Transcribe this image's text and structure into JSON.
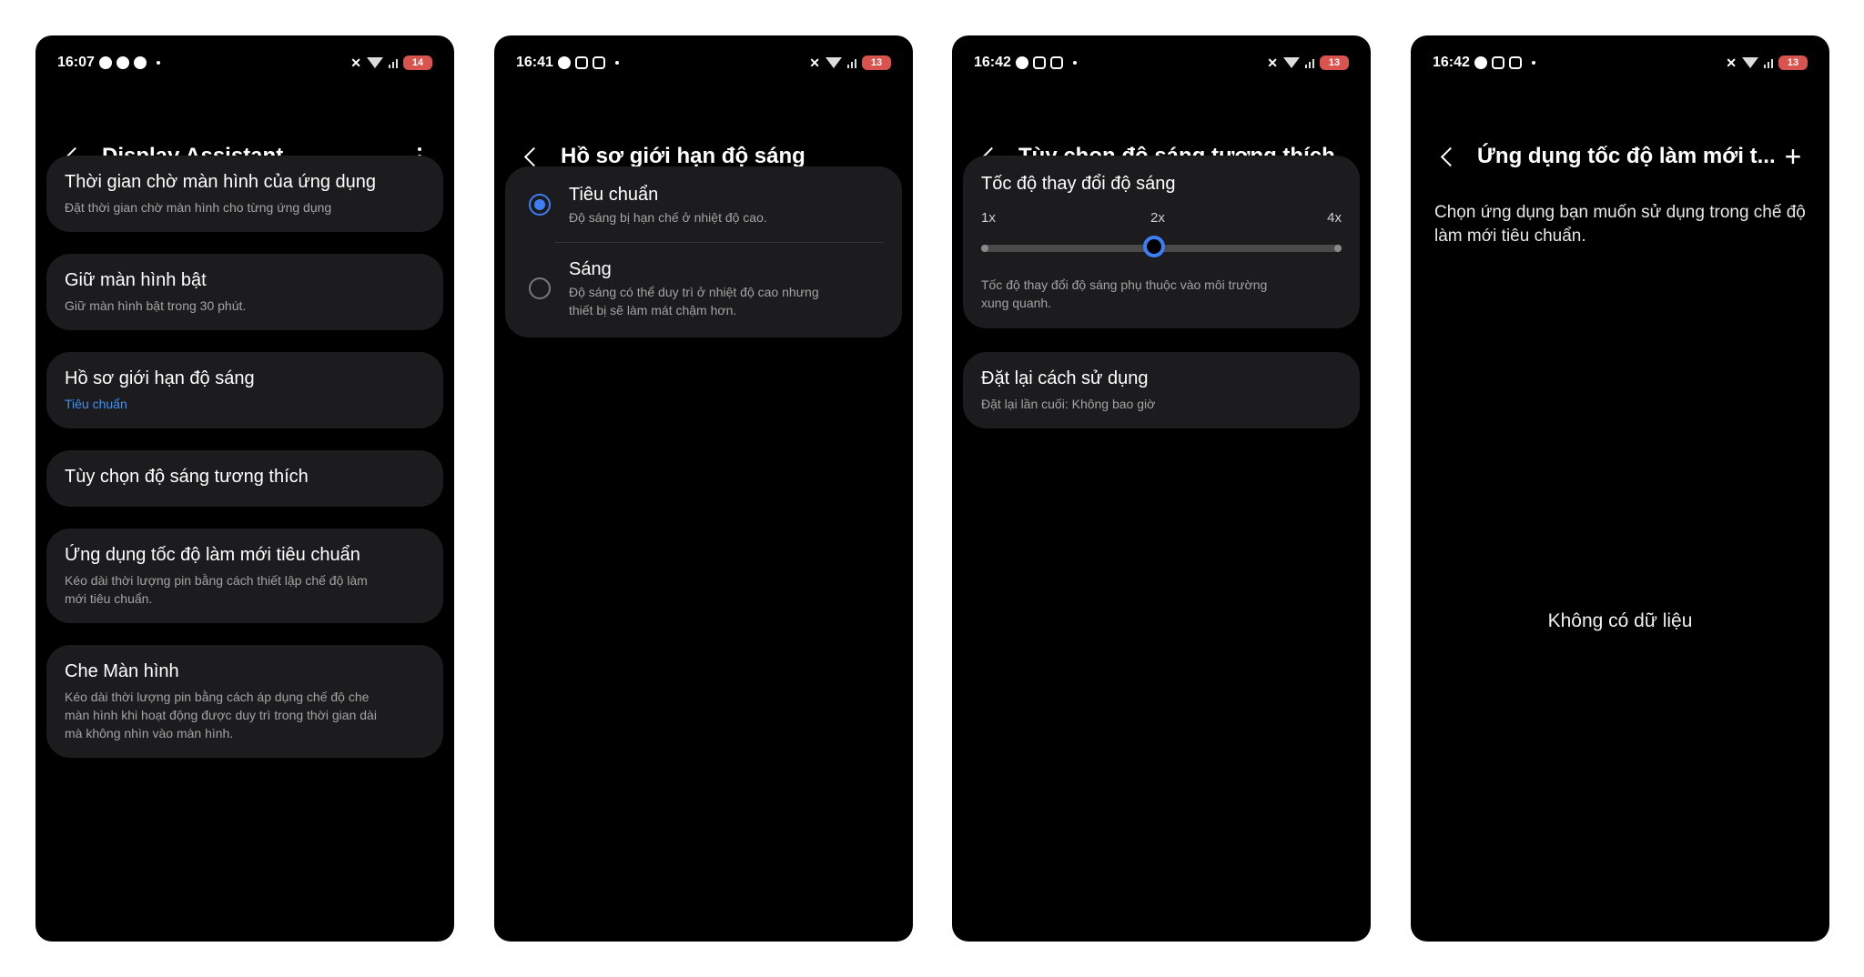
{
  "screens": [
    {
      "time": "16:07",
      "battery": "14",
      "title": "Display Assistant",
      "items": [
        {
          "title": "Thời gian chờ màn hình của ứng dụng",
          "sub": "Đặt thời gian chờ màn hình cho từng ứng dụng"
        },
        {
          "title": "Giữ màn hình bật",
          "sub": "Giữ màn hình bật trong 30 phút."
        },
        {
          "title": "Hồ sơ giới hạn độ sáng",
          "sub": "Tiêu chuẩn"
        },
        {
          "title": "Tùy chọn độ sáng tương thích"
        },
        {
          "title": "Ứng dụng tốc độ làm mới tiêu chuẩn",
          "sub1": "Kéo dài thời lượng pin bằng cách thiết lập chế độ làm",
          "sub2": "mới tiêu chuẩn."
        },
        {
          "title": "Che Màn hình",
          "sub1": "Kéo dài thời lượng pin bằng cách áp dụng chế độ che",
          "sub2": "màn hình khi hoạt động được duy trì trong thời gian dài",
          "sub3": "mà không nhìn vào màn hình."
        }
      ]
    },
    {
      "time": "16:41",
      "battery": "13",
      "title": "Hồ sơ giới hạn độ sáng",
      "options": [
        {
          "title": "Tiêu chuẩn",
          "sub": "Độ sáng bị hạn chế ở nhiệt độ cao.",
          "selected": true
        },
        {
          "title": "Sáng",
          "sub1": "Độ sáng có thể duy trì ở nhiệt độ cao nhưng",
          "sub2": "thiết bị sẽ làm mát chậm hơn.",
          "selected": false
        }
      ]
    },
    {
      "time": "16:42",
      "battery": "13",
      "title": "Tùy chọn độ sáng tương thích",
      "speed_title": "Tốc độ thay đổi độ sáng",
      "ticks": [
        "1x",
        "2x",
        "4x"
      ],
      "slider_value": "2x",
      "speed_desc1": "Tốc độ thay đổi độ sáng phụ thuộc vào môi trường",
      "speed_desc2": "xung quanh.",
      "reset_title": "Đặt lại cách sử dụng",
      "reset_sub": "Đặt lại lần cuối: Không bao giờ"
    },
    {
      "time": "16:42",
      "battery": "13",
      "title": "Ứng dụng tốc độ làm mới t...",
      "desc1": "Chọn ứng dụng bạn muốn sử dụng trong chế độ",
      "desc2": "làm mới tiêu chuẩn.",
      "empty": "Không có dữ liệu"
    }
  ],
  "colors": {
    "accent": "#3b7ef5",
    "card": "#1c1c1e",
    "link": "#3e91f7",
    "battery": "#d9534f"
  }
}
